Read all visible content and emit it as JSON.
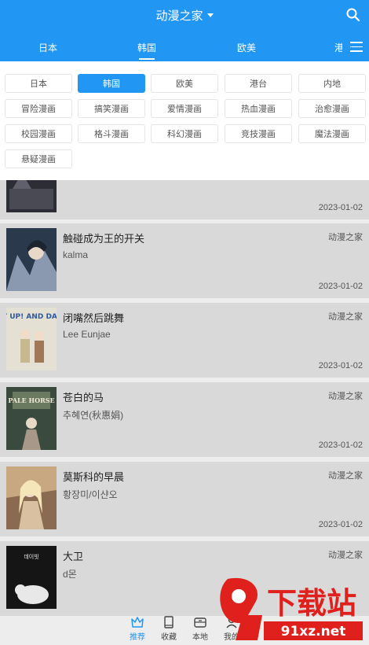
{
  "header": {
    "title": "动漫之家",
    "tabs": [
      {
        "label": "日本"
      },
      {
        "label": "韩国"
      },
      {
        "label": "欧美"
      }
    ],
    "tab_clipped": "港台"
  },
  "filters": {
    "row1": [
      "日本",
      "韩国",
      "欧美",
      "港台",
      "内地"
    ],
    "row2": [
      "冒险漫画",
      "搞笑漫画",
      "爱情漫画",
      "热血漫画",
      "治愈漫画"
    ],
    "row3": [
      "校园漫画",
      "格斗漫画",
      "科幻漫画",
      "竞技漫画",
      "魔法漫画"
    ],
    "row4": [
      "悬疑漫画"
    ],
    "active": "韩国"
  },
  "list": {
    "partial_date": "2023-01-02",
    "items": [
      {
        "name": "触碰成为王的开关",
        "author": "kalma",
        "source": "动漫之家",
        "date": "2023-01-02"
      },
      {
        "name": "闭嘴然后跳舞",
        "author": "Lee Eunjae",
        "source": "动漫之家",
        "date": "2023-01-02",
        "cover_text": "SHUT UP! AND DANCE?"
      },
      {
        "name": "苍白的马",
        "author": "추혜연(秋惠娟)",
        "source": "动漫之家",
        "date": "2023-01-02",
        "cover_text": "PALE HORSE"
      },
      {
        "name": "莫斯科的早晨",
        "author": "황장미/이샨오",
        "source": "动漫之家",
        "date": "2023-01-02"
      },
      {
        "name": "大卫",
        "author": "d몬",
        "source": "动漫之家",
        "cover_text": "데이빗"
      }
    ]
  },
  "bottom_nav": {
    "items": [
      {
        "label": "推荐"
      },
      {
        "label": "收藏"
      },
      {
        "label": "本地"
      },
      {
        "label": "我的"
      }
    ]
  },
  "watermark": {
    "text": "下载站",
    "url": "91xz.net"
  },
  "colors": {
    "accent": "#2196F3"
  }
}
